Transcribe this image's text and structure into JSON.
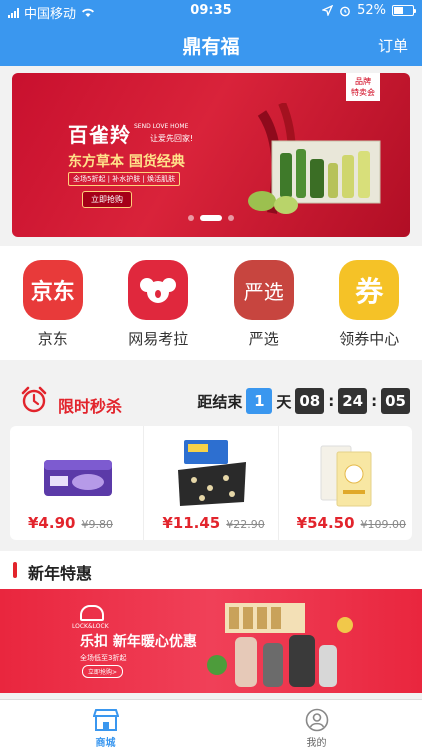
{
  "status_bar": {
    "carrier": "中国移动",
    "time": "09:35",
    "battery": "52%",
    "battery_level": 0.52
  },
  "header": {
    "title": "鼎有福",
    "orders_label": "订单"
  },
  "banner": {
    "ribbon_line1": "品牌",
    "ribbon_line2": "特卖会",
    "brand_cn": "百雀羚",
    "brand_en": "SEND LOVE HOME",
    "brand_sub": "让爱先回家!",
    "slogan": "东方草本 国货经典",
    "tag": "全场5折起 | 补水护肤 | 焕活肌肤",
    "cta": "立即抢购",
    "slide_count": 3,
    "active_slide": 1
  },
  "categories": [
    {
      "label": "京东",
      "icon_text": "京东",
      "color": "#e83a3a"
    },
    {
      "label": "网易考拉",
      "icon_text": "",
      "color": "#e0283d"
    },
    {
      "label": "严选",
      "icon_text": "严选",
      "color": "#c7453f"
    },
    {
      "label": "领券中心",
      "icon_text": "券",
      "color": "#f5c227"
    }
  ],
  "flash_sale": {
    "title": "限时秒杀",
    "countdown_label": "距结束",
    "days": "1",
    "day_unit": "天",
    "hours": "08",
    "minutes": "24",
    "seconds": "05",
    "items": [
      {
        "price": "¥4.90",
        "old_price": "¥9.80"
      },
      {
        "price": "¥11.45",
        "old_price": "¥22.90"
      },
      {
        "price": "¥54.50",
        "old_price": "¥109.00"
      }
    ]
  },
  "new_year": {
    "title": "新年特惠",
    "logo_text": "LOCK&LOCK",
    "headline": "乐扣 新年暖心优惠",
    "sub": "全场低至3折起",
    "cta": "立即抢购>"
  },
  "tabbar": {
    "tabs": [
      {
        "label": "商城",
        "icon": "store-icon",
        "active": true
      },
      {
        "label": "我的",
        "icon": "user-icon",
        "active": false
      }
    ]
  },
  "colors": {
    "primary": "#3a97ef",
    "accent_red": "#e2242c"
  }
}
